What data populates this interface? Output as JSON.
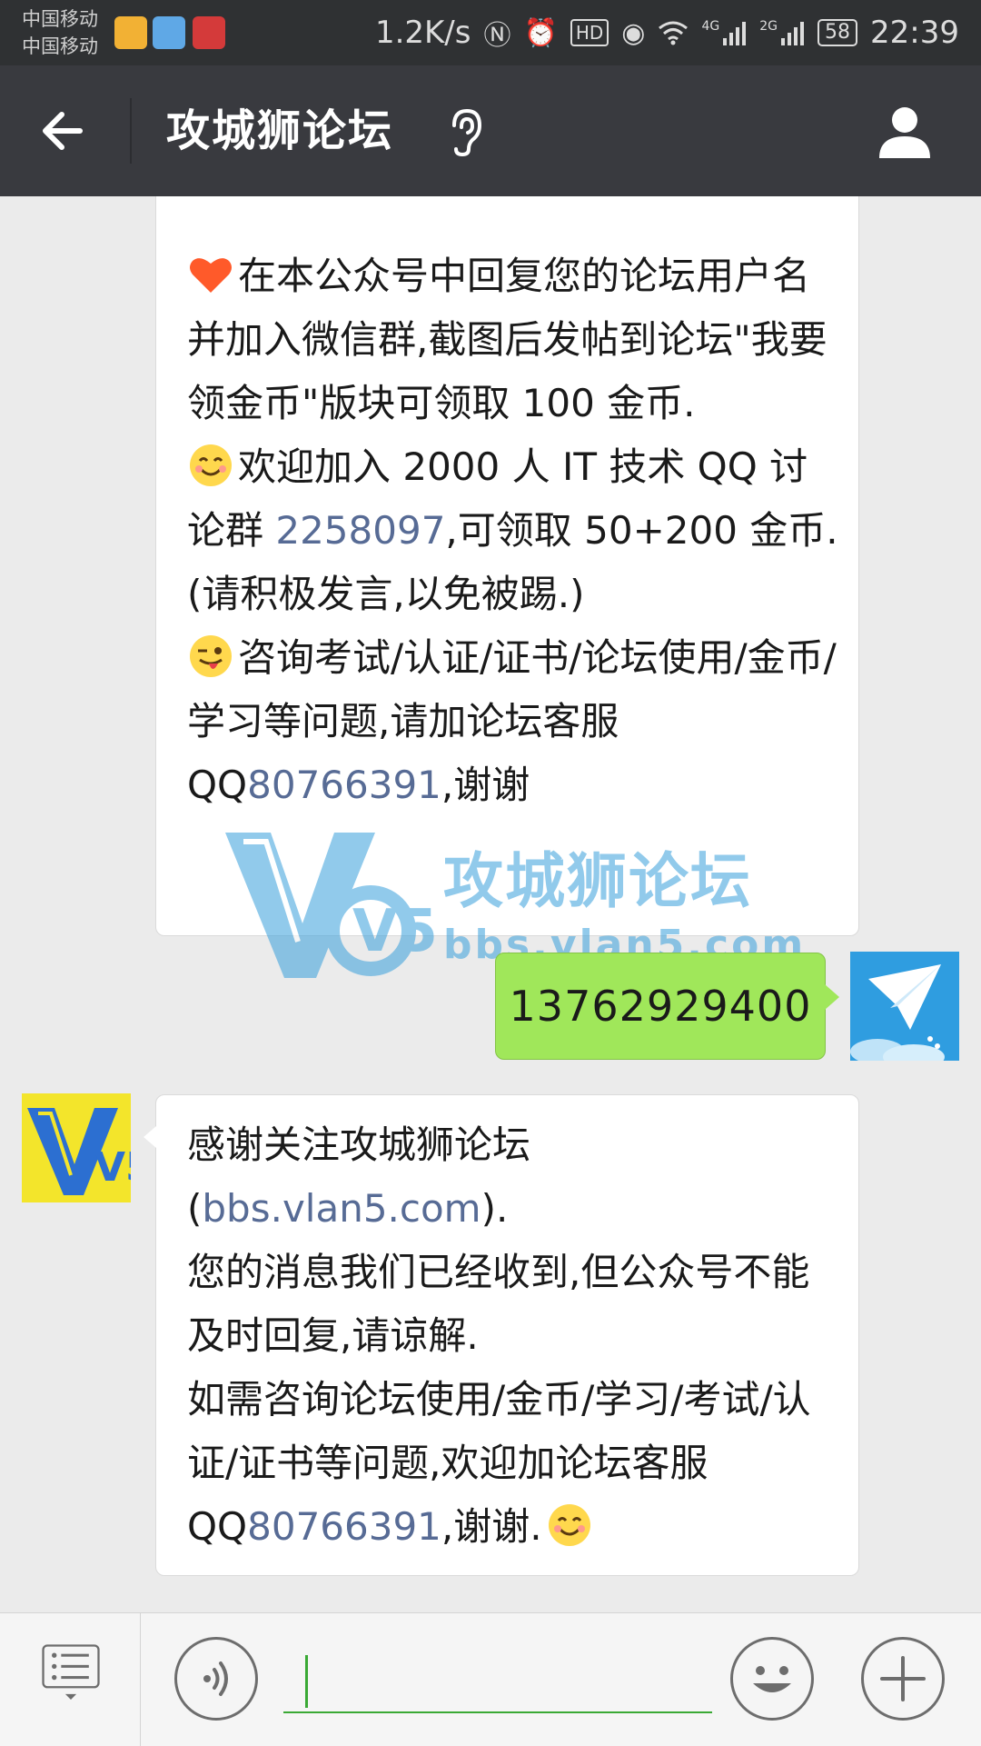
{
  "status_bar": {
    "carrier_1": "中国移动",
    "carrier_2": "中国移动",
    "network_speed": "1.2K/s",
    "hd_label": "HD",
    "signal_1_label": "4G",
    "signal_2_label": "2G",
    "battery": "58",
    "time": "22:39"
  },
  "nav": {
    "title": "攻城狮论坛"
  },
  "messages": {
    "msg1": {
      "p1_text": "在本公众号中回复您的论坛用户名并加入微信群,截图后发帖到论坛\"我要领金币\"版块可领取 100 金币.",
      "p2_before": "欢迎加入 2000 人 IT 技术 QQ 讨论群 ",
      "p2_link": "2258097",
      "p2_after": ",可领取 50+200 金币.(请积极发言,以免被踢.)",
      "p3_before": "咨询考试/认证/证书/论坛使用/金币/学习等问题,请加论坛客服 QQ",
      "p3_link": "80766391",
      "p3_after": ",谢谢"
    },
    "msg2": {
      "text": "13762929400"
    },
    "msg3": {
      "p1_before": "感谢关注攻城狮论坛(",
      "p1_link": "bbs.vlan5.com",
      "p1_after": ").",
      "p2": "您的消息我们已经收到,但公众号不能及时回复,请谅解.",
      "p3_before": "如需咨询论坛使用/金币/学习/考试/认证/证书等问题,欢迎加论坛客服 QQ",
      "p3_link": "80766391",
      "p3_after": ",谢谢."
    }
  },
  "watermark": {
    "logo_text": "V5",
    "title": "攻城狮论坛",
    "url": "bbs.vlan5.com"
  },
  "account_avatar_text": "V5",
  "input": {
    "placeholder": "",
    "value": ""
  },
  "colors": {
    "nav_bg": "#393a3f",
    "chat_bg": "#ebebeb",
    "outgoing_bubble": "#a0e75a",
    "link": "#576b95",
    "input_accent": "#3aa935"
  },
  "icons": {
    "back": "arrow-left-icon",
    "ear": "ear-icon",
    "user": "user-icon",
    "menu": "menu-list-icon",
    "voice": "voice-icon",
    "emoji": "smiley-icon",
    "plus": "plus-icon"
  }
}
